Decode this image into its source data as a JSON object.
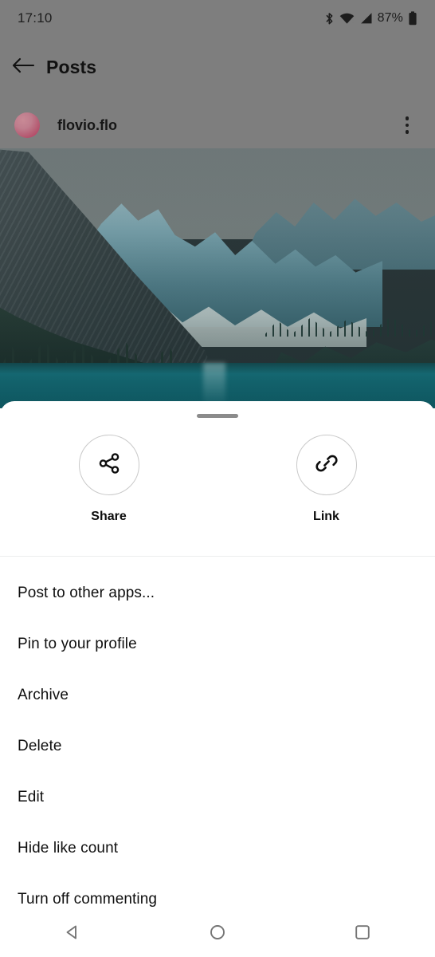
{
  "status_bar": {
    "time": "17:10",
    "battery_percent": "87%",
    "icons": [
      "bluetooth-icon",
      "wifi-icon",
      "cellular-signal-icon",
      "battery-icon"
    ]
  },
  "app_bar": {
    "back_icon": "back-arrow-icon",
    "title": "Posts"
  },
  "post_header": {
    "username": "flovio.flo",
    "avatar": "avatar",
    "overflow_icon": "overflow-menu-icon"
  },
  "post_image": {
    "description": "mountain lake photo"
  },
  "sheet": {
    "handle": "drag-handle",
    "quick_actions": [
      {
        "label": "Share",
        "icon": "share-icon"
      },
      {
        "label": "Link",
        "icon": "link-icon"
      }
    ],
    "menu_items": [
      "Post to other apps...",
      "Pin to your profile",
      "Archive",
      "Delete",
      "Edit",
      "Hide like count",
      "Turn off commenting"
    ]
  },
  "nav_bar": {
    "buttons": [
      "back-nav-icon",
      "home-nav-icon",
      "recents-nav-icon"
    ]
  },
  "colors": {
    "scrim": "#7e7e7e",
    "sheet_bg": "#ffffff",
    "text": "#0f0f0f",
    "divider": "#eceded",
    "water": "#14707b"
  }
}
